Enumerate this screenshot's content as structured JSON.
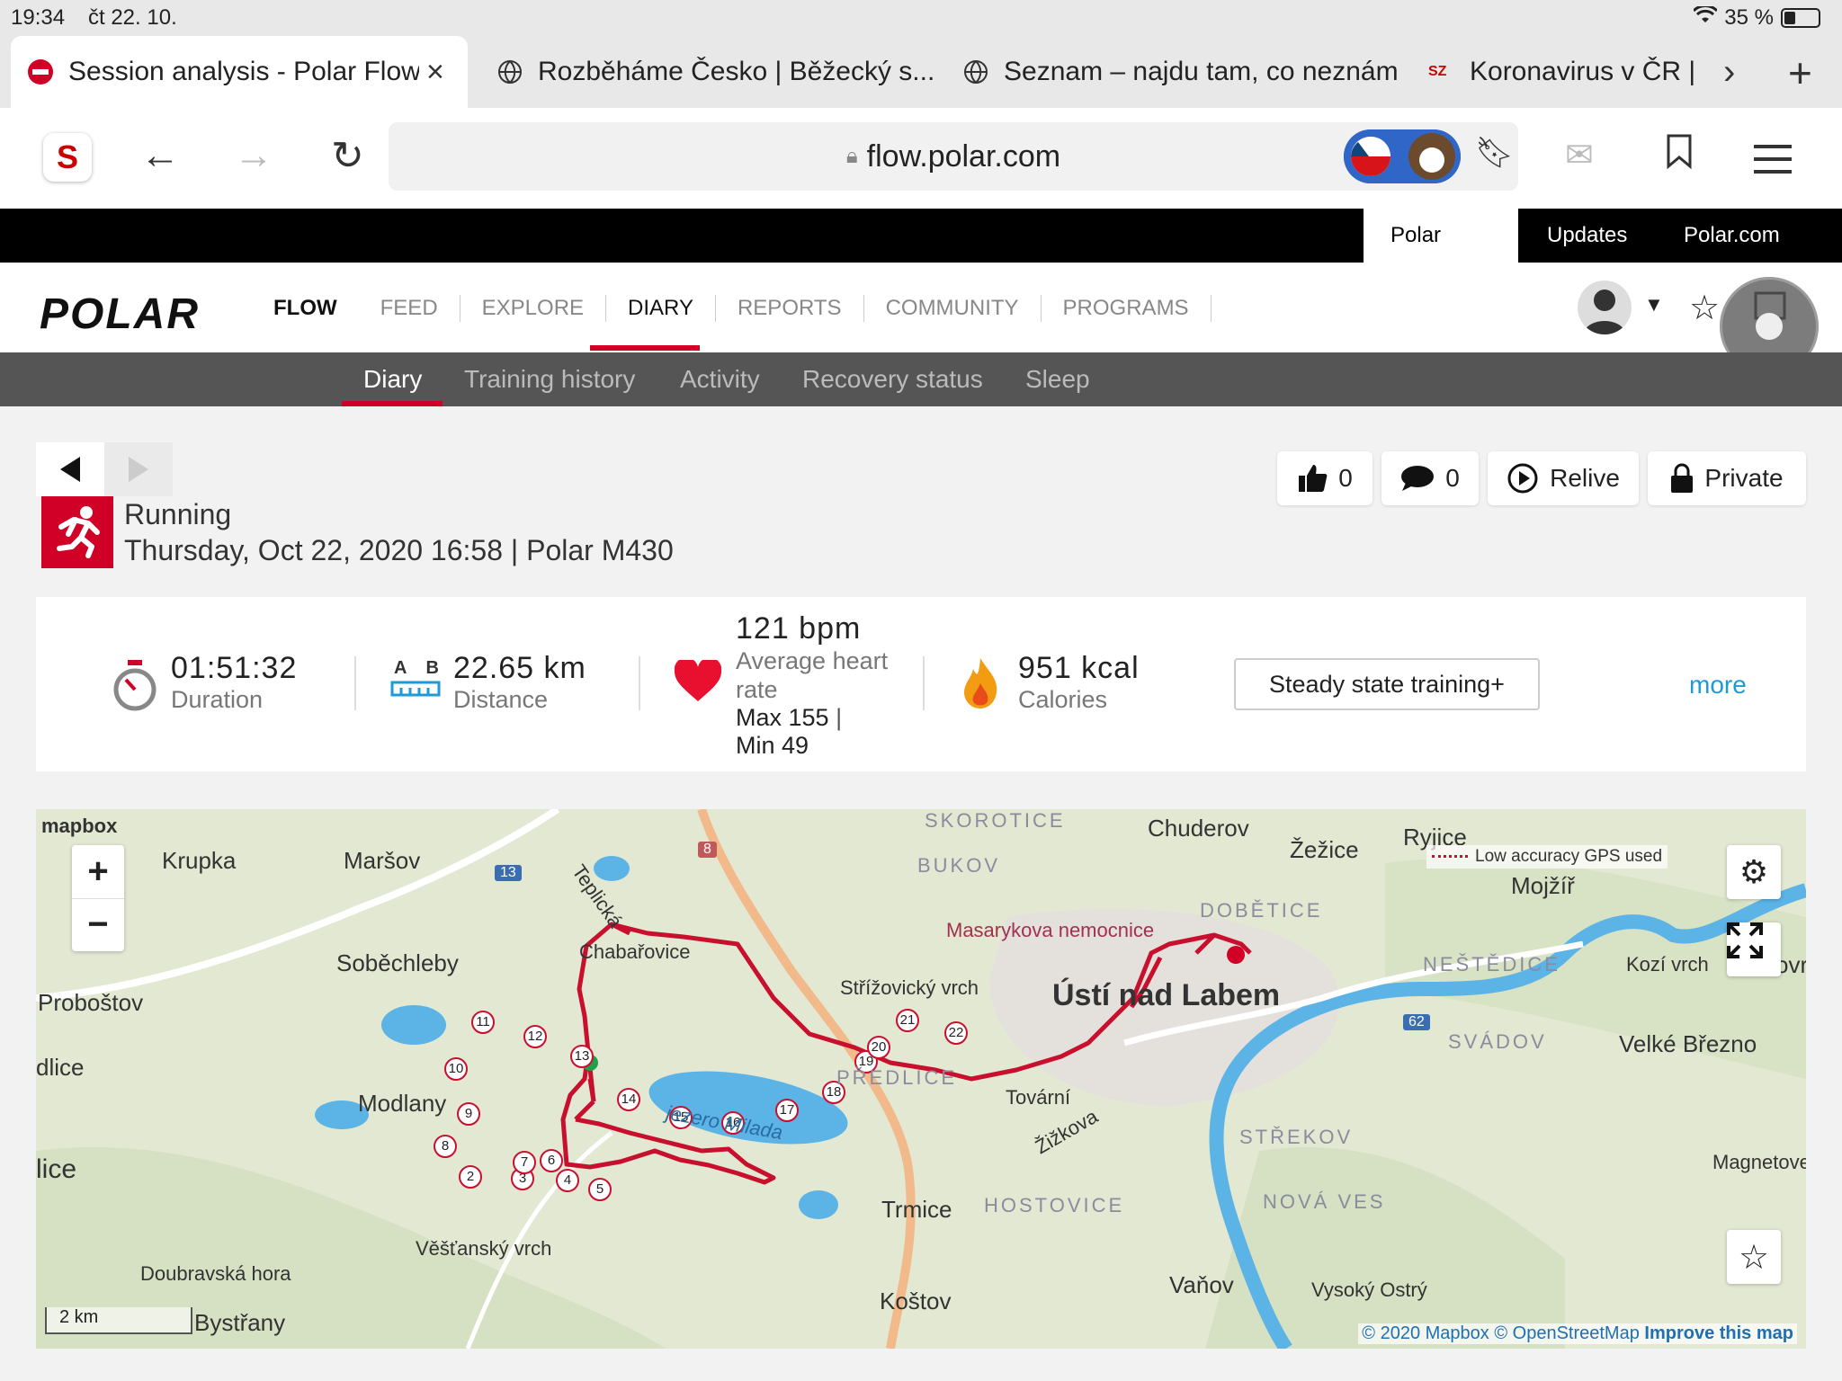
{
  "status": {
    "time": "19:34",
    "date": "čt 22. 10.",
    "battery": "35 %"
  },
  "tabs": [
    {
      "title": "Session analysis - Polar Flow"
    },
    {
      "title": "Rozběháme Česko | Běžecký s..."
    },
    {
      "title": "Seznam – najdu tam, co neznám"
    },
    {
      "title": "Koronavirus v ČR |"
    }
  ],
  "tab_favicon_sz": "SZ",
  "url": {
    "host": "flow.polar.com"
  },
  "top_links": {
    "flow": "Polar Flow",
    "updates": "Updates",
    "polar": "Polar.com"
  },
  "brand": {
    "logo": "POLAR",
    "flow": "FLOW"
  },
  "main_nav": {
    "feed": "FEED",
    "explore": "EXPLORE",
    "diary": "DIARY",
    "reports": "REPORTS",
    "community": "COMMUNITY",
    "programs": "PROGRAMS"
  },
  "sub_nav": {
    "diary": "Diary",
    "training": "Training history",
    "activity": "Activity",
    "recovery": "Recovery status",
    "sleep": "Sleep"
  },
  "actions": {
    "likes": "0",
    "comments": "0",
    "relive": "Relive",
    "private": "Private"
  },
  "session": {
    "sport": "Running",
    "subtitle": "Thursday, Oct 22, 2020 16:58 | Polar M430"
  },
  "summary": {
    "duration": "01:51:32",
    "duration_label": "Duration",
    "distance": "22.65 km",
    "distance_label": "Distance",
    "distance_ab_a": "A",
    "distance_ab_b": "B",
    "hr": "121 bpm",
    "hr_label": "Average heart rate",
    "hr_max": "Max 155",
    "hr_min": "Min 49",
    "calories": "951 kcal",
    "calories_label": "Calories",
    "benefit": "Steady state training+",
    "more": "more"
  },
  "map": {
    "logo": "mapbox",
    "gps_note": "Low accuracy GPS used",
    "scale": "2 km",
    "attribution_1": "© 2020 Mapbox",
    "attribution_2": "© OpenStreetMap",
    "attribution_3": "Improve this map",
    "zoom_in": "+",
    "zoom_out": "−",
    "labels": {
      "krupka": "Krupka",
      "marsov": "Maršov",
      "sobechleby": "Soběchleby",
      "probostov": "Proboštov",
      "dlice": "dlice",
      "lice": "lice",
      "modlany": "Modlany",
      "vestansky": "Věšťanský vrch",
      "doubravska": "Doubravská hora",
      "bystrany": "Bystřany",
      "teplicka": "Teplická",
      "chlumec": "Chabařovice",
      "lake": "jezero Milada",
      "skorotice": "SKOROTICE",
      "bukov": "BUKOV",
      "strizovicky": "Střížovický vrch",
      "hospital": "Masarykova nemocnice",
      "chuderov": "Chuderov",
      "zezice": "Žežice",
      "rybice": "Ryjice",
      "mojzir": "Mojžíř",
      "dobetice": "DOBĚTICE",
      "nestedice": "NEŠTĚDICE",
      "kozi": "Kozí vrch",
      "ovr": "ovr",
      "usti": "Ústí nad Labem",
      "svadov": "SVÁDOV",
      "velke": "Velké Březno",
      "tovarni": "Tovární",
      "zizkova": "Žižkova",
      "strekov": "STŘEKOV",
      "magnetove": "Magnetove",
      "trmice": "Trmice",
      "hostovice": "HOSTOVICE",
      "nova_ves": "NOVÁ VES",
      "kostov": "Koštov",
      "vanov": "Vaňov",
      "vysoky": "Vysoký Ostrý",
      "predlice": "PŘEDLICE",
      "road8": "8",
      "road13": "13",
      "road62": "62"
    },
    "km_markers": [
      "2",
      "3",
      "4",
      "5",
      "6",
      "7",
      "8",
      "9",
      "10",
      "11",
      "12",
      "13",
      "14",
      "15",
      "16",
      "17",
      "18",
      "19",
      "20",
      "21",
      "22"
    ]
  },
  "colors": {
    "accent": "#d10027",
    "link": "#1e9ad6",
    "route": "#c8102e",
    "water": "#5bb3e6"
  }
}
